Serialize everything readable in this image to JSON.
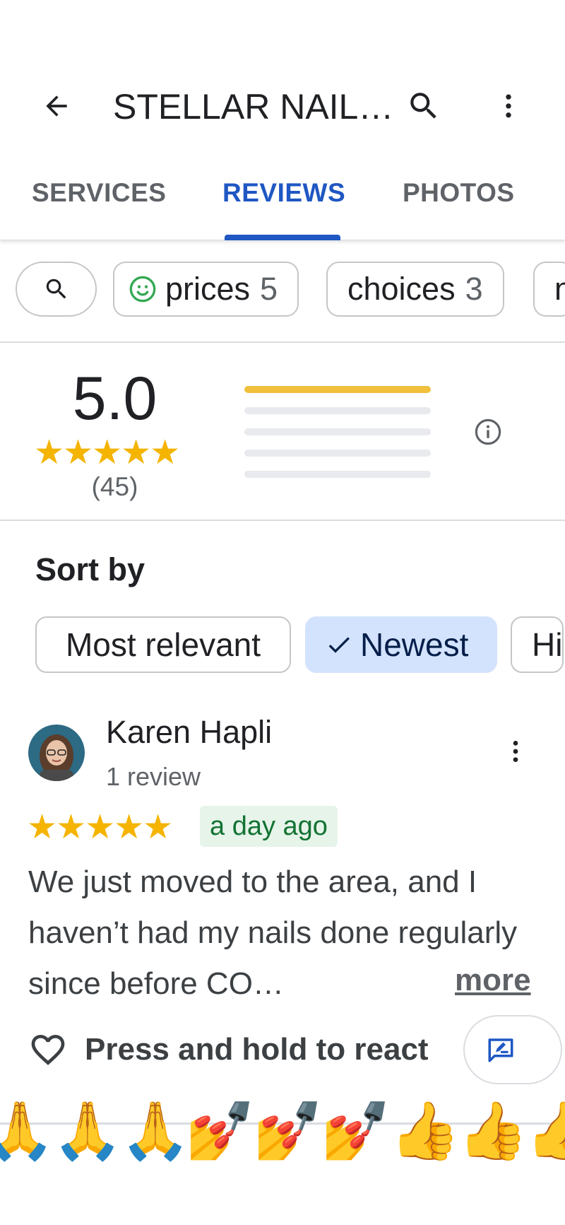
{
  "header": {
    "title": "STELLAR NAIL…"
  },
  "tabs": [
    {
      "label": "SERVICES",
      "active": false
    },
    {
      "label": "REVIEWS",
      "active": true
    },
    {
      "label": "PHOTOS",
      "active": false
    }
  ],
  "topic_chips": [
    {
      "label": "prices",
      "count": "5",
      "icon": "smiley-icon"
    },
    {
      "label": "choices",
      "count": "3"
    },
    {
      "label": "n",
      "count": ""
    }
  ],
  "rating": {
    "average": "5.0",
    "stars": 5,
    "count_label": "(45)",
    "distribution": [
      1.0,
      0.0,
      0.0,
      0.0,
      0.0
    ]
  },
  "sort": {
    "label": "Sort by",
    "options": [
      {
        "label": "Most relevant",
        "selected": false
      },
      {
        "label": "Newest",
        "selected": true
      },
      {
        "label": "Hi",
        "selected": false
      }
    ]
  },
  "review": {
    "author": "Karen Hapli",
    "author_sub": "1 review",
    "stars": 5,
    "date": "a day ago",
    "text": "We just moved to the area, and I haven’t had my nails done regularly since before CO…",
    "more_label": "more",
    "react_label": "Press and hold to react"
  },
  "emoji_strip": [
    "🙏",
    "🙏",
    "🙏",
    "💅",
    "💅",
    "💅",
    "👍",
    "👍",
    "👍"
  ],
  "colors": {
    "accent": "#1f57c3",
    "star": "#f4b400",
    "date_bg": "#e6f4ea",
    "date_text": "#137333",
    "selected_chip": "#d3e3fd"
  }
}
